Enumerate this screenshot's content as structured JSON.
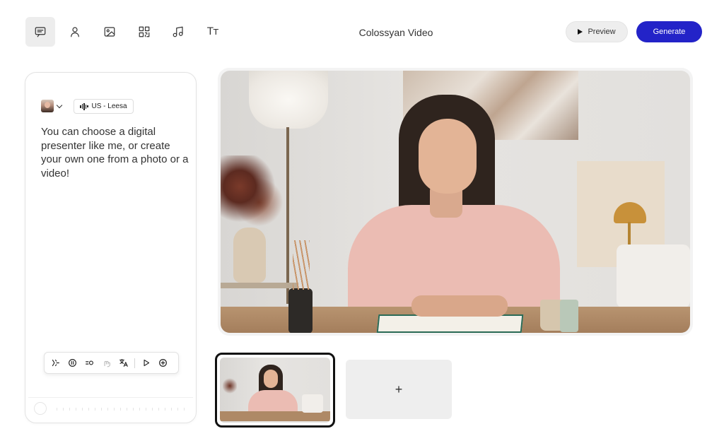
{
  "toolbar": {
    "tools": [
      {
        "name": "script",
        "icon": "message-square-icon",
        "active": true
      },
      {
        "name": "avatar",
        "icon": "person-icon",
        "active": false
      },
      {
        "name": "image",
        "icon": "image-icon",
        "active": false
      },
      {
        "name": "qr",
        "icon": "qr-code-icon",
        "active": false
      },
      {
        "name": "music",
        "icon": "music-note-icon",
        "active": false
      },
      {
        "name": "text",
        "icon": "text-size-icon",
        "label": "Tт",
        "active": false
      }
    ]
  },
  "header": {
    "title": "Colossyan Video",
    "preview_label": "Preview",
    "generate_label": "Generate"
  },
  "colors": {
    "accent": "#2323c8",
    "active_tool_bg": "#ededed",
    "thumb_border": "#111111"
  },
  "script_panel": {
    "voice_label": "US - Leesa",
    "script_text": "You can choose a digital presenter like me, or create your own one from a photo or a video!",
    "toolbar_icons": [
      "sparkle-icon",
      "pause-icon",
      "pace-icon",
      "gesture-icon",
      "translate-icon",
      "play-icon",
      "add-circle-icon"
    ]
  },
  "scenes": {
    "add_label": "+"
  }
}
